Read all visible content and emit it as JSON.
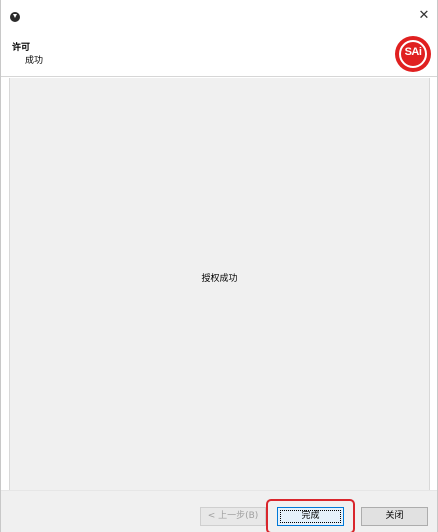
{
  "header": {
    "title": "许可",
    "subtitle": "成功",
    "logo_text": "SAi"
  },
  "content": {
    "message": "授权成功"
  },
  "footer": {
    "back_label": "< 上一步(B)",
    "finish_label": "完成",
    "close_label": "关闭"
  },
  "colors": {
    "logo_red": "#e02020",
    "highlight_red": "#d9262c",
    "focus_blue": "#0078d7"
  }
}
